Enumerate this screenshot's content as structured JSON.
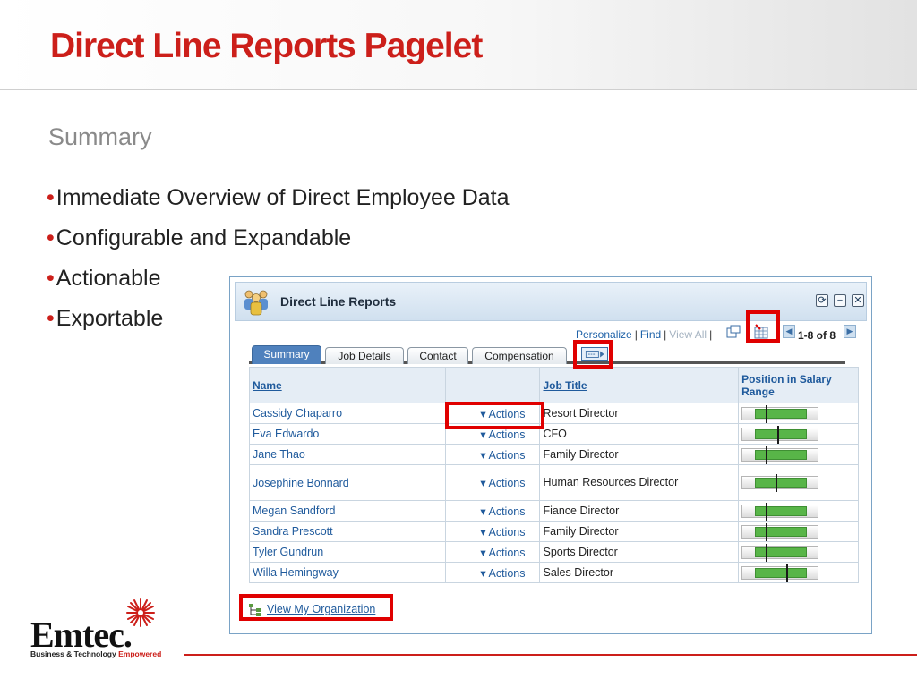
{
  "slide": {
    "title": "Direct Line Reports Pagelet",
    "subtitle": "Summary",
    "bullets": [
      "Immediate Overview of Direct Employee Data",
      "Configurable and Expandable",
      "Actionable",
      "Exportable"
    ],
    "bullet_symbol": "•"
  },
  "pagelet": {
    "title": "Direct Line Reports",
    "header_buttons": {
      "refresh": "⟳",
      "minimize": "−",
      "close": "✕"
    },
    "toolbar": {
      "personalize": "Personalize",
      "find": "Find",
      "view_all": "View All",
      "separator": "|"
    },
    "paging": "1-8 of 8",
    "tabs": [
      "Summary",
      "Job Details",
      "Contact",
      "Compensation"
    ],
    "columns": {
      "name": "Name",
      "actions": "",
      "job_title": "Job Title",
      "position": "Position in Salary Range"
    },
    "rows": [
      {
        "name": "Cassidy Chaparro",
        "action": "Actions",
        "job_title": "Resort Director",
        "position": 0.2
      },
      {
        "name": "Eva Edwardo",
        "action": "Actions",
        "job_title": "CFO",
        "position": 0.43
      },
      {
        "name": "Jane Thao",
        "action": "Actions",
        "job_title": "Family Director",
        "position": 0.2
      },
      {
        "name": "Josephine Bonnard",
        "action": "Actions",
        "job_title": "Human Resources Director",
        "position": 0.4
      },
      {
        "name": "Megan Sandford",
        "action": "Actions",
        "job_title": "Fiance Director",
        "position": 0.2
      },
      {
        "name": "Sandra Prescott",
        "action": "Actions",
        "job_title": "Family Director",
        "position": 0.2
      },
      {
        "name": "Tyler Gundrun",
        "action": "Actions",
        "job_title": "Sports Director",
        "position": 0.2
      },
      {
        "name": "Willa Hemingway",
        "action": "Actions",
        "job_title": "Sales Director",
        "position": 0.6
      }
    ],
    "org_link": "View My Organization"
  },
  "logo": {
    "name": "Emtec",
    "mark": ".",
    "tagline": "Business & Technology",
    "tagline_accent": "Empowered"
  },
  "colors": {
    "brand_red": "#cc1f1a",
    "link_blue": "#1f5a9c",
    "tab_active": "#4f81bd",
    "range_green": "#58b548",
    "highlight": "#e00000"
  }
}
